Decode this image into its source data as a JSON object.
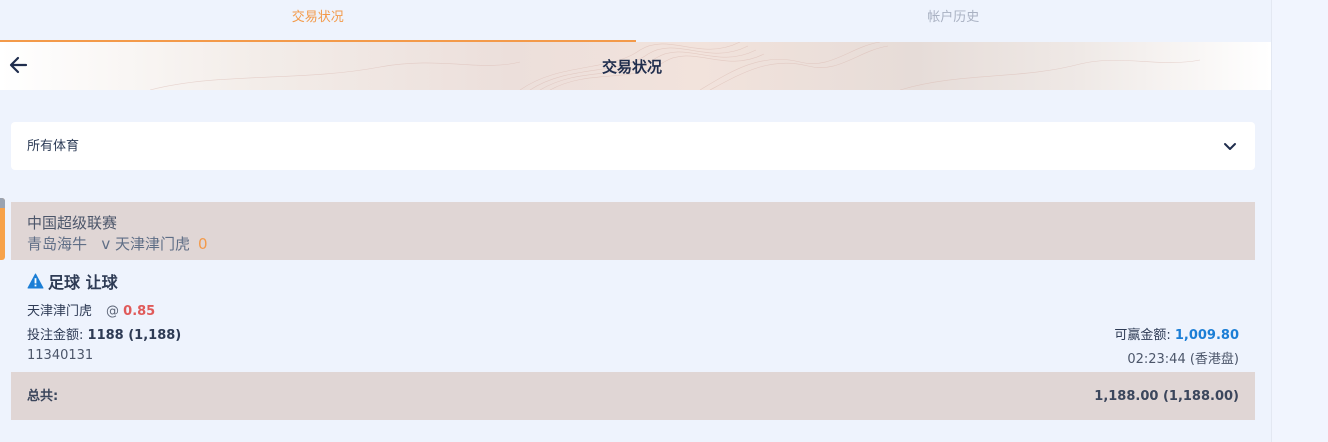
{
  "tabs": [
    {
      "label": "交易状况",
      "active": true
    },
    {
      "label": "帐户历史",
      "active": false
    }
  ],
  "header": {
    "title": "交易状况",
    "back_icon": "arrow-left-icon"
  },
  "filter": {
    "selected": "所有体育",
    "icon": "chevron-down-icon"
  },
  "bet": {
    "league": "中国超级联赛",
    "home": "青岛海牛",
    "vs": "v",
    "away": "天津津门虎",
    "score": "0",
    "warning_icon": "warning-triangle-icon",
    "bet_type": "足球 让球",
    "selection": "天津津门虎",
    "at": "@",
    "odds": "0.85",
    "stake_label": "投注金额:",
    "stake_value": "1188 (1,188)",
    "win_label": "可赢金额:",
    "win_value": "1,009.80",
    "ref_no": "11340131",
    "time": "02:23:44 (香港盘)"
  },
  "total": {
    "label": "总共:",
    "value": "1,188.00 (1,188.00)"
  },
  "colors": {
    "accent": "#f39a4a",
    "odds": "#e05a5a",
    "win": "#1b7ed6",
    "card_header_bg": "#e0d6d5",
    "page_bg": "#eef3fd"
  }
}
